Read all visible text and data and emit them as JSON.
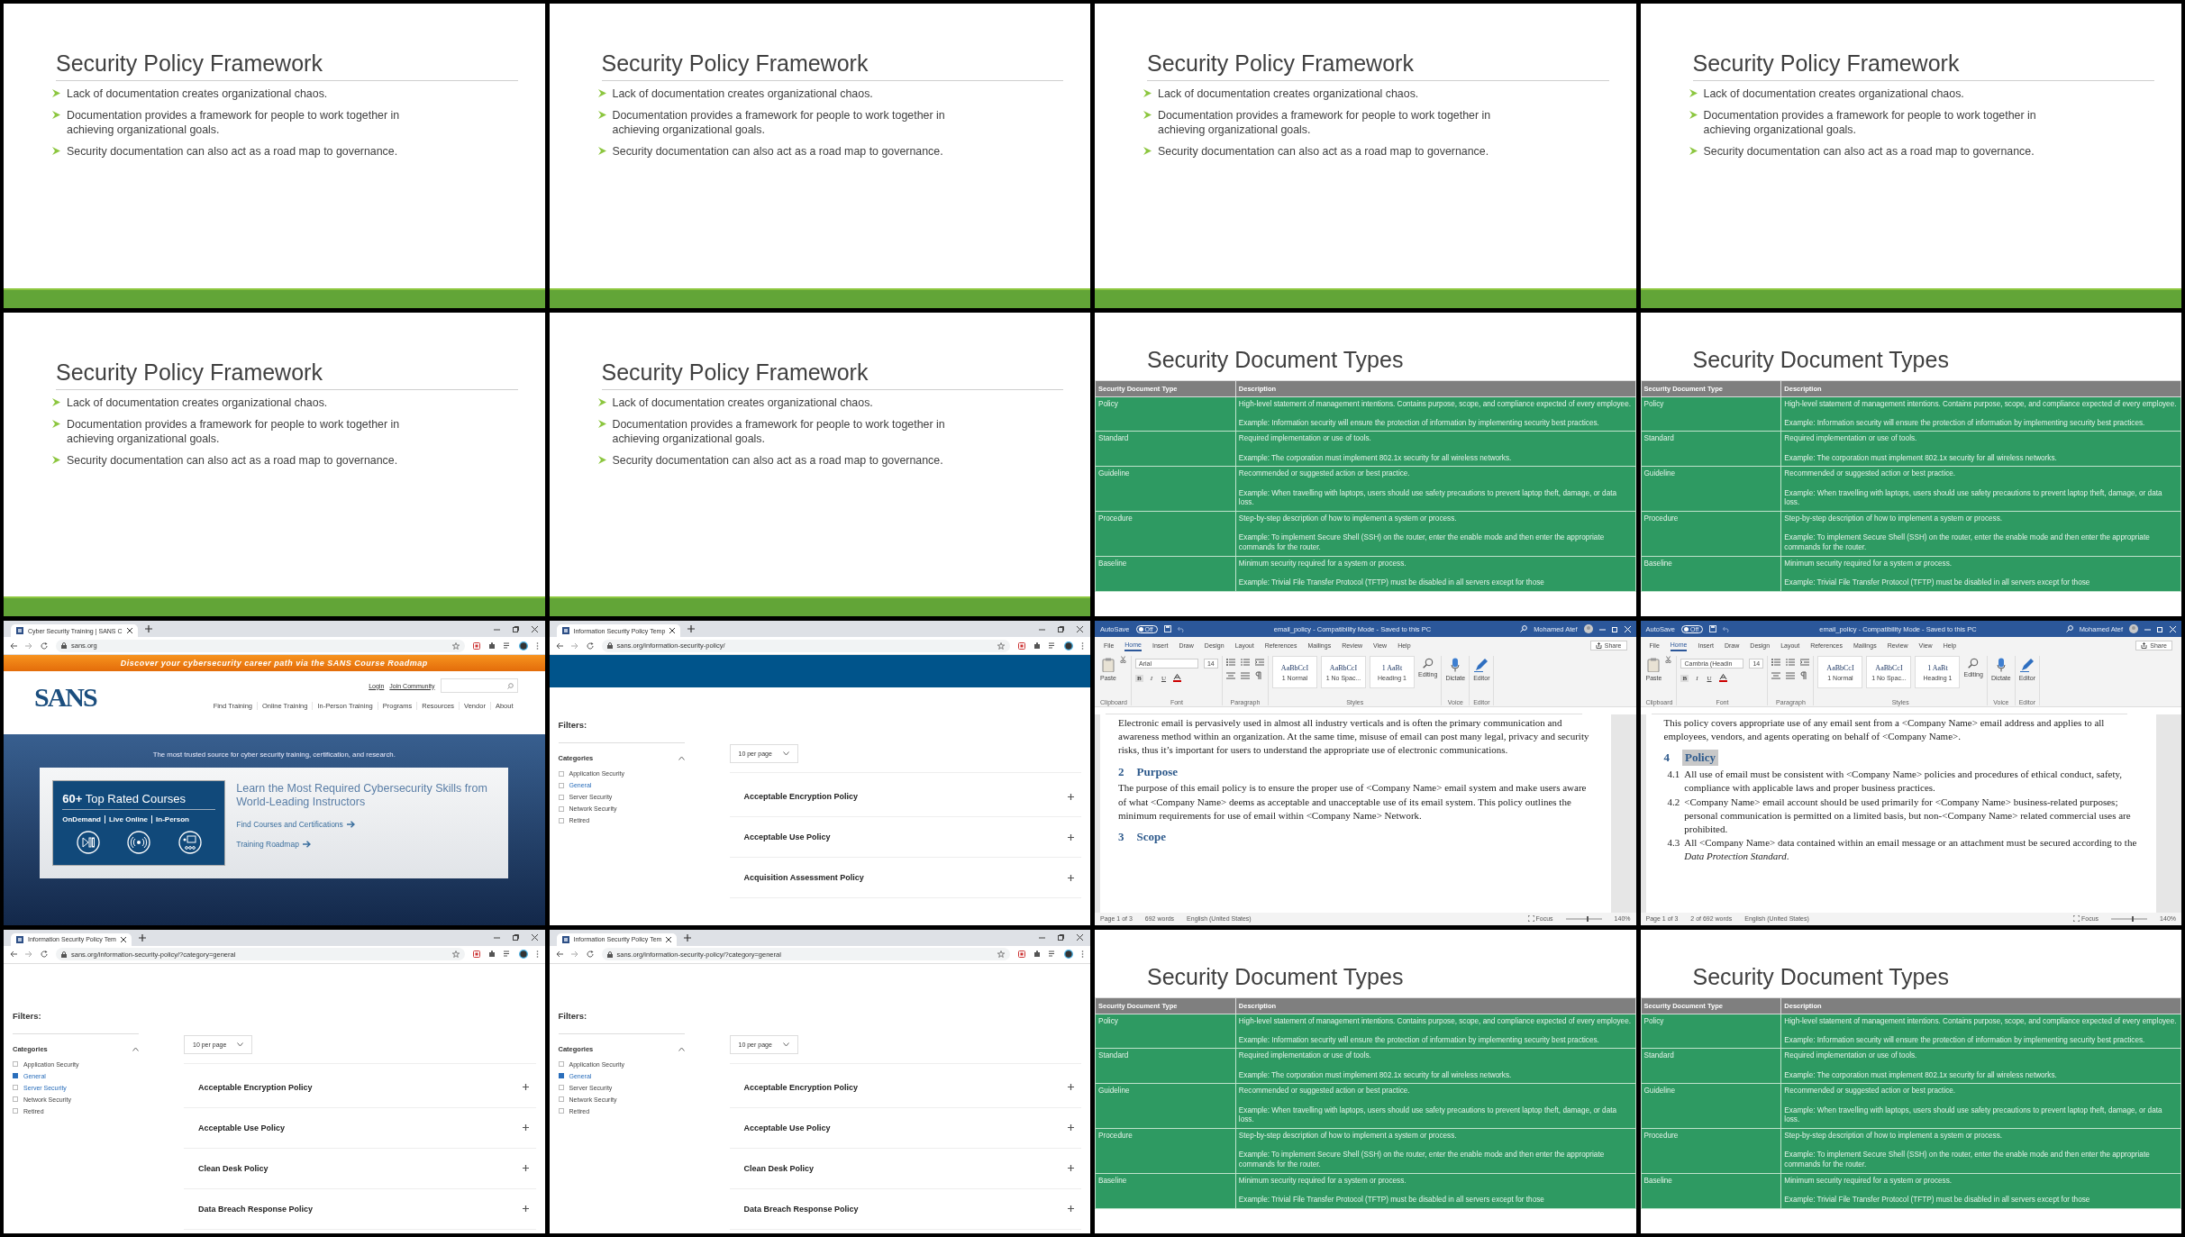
{
  "frames": [
    {
      "kind": "bullet_slide",
      "title": "Security Policy Framework",
      "bullets": [
        "Lack of documentation creates organizational chaos.",
        "Documentation provides a framework for people to work together in achieving organizational goals.",
        "Security documentation can also act as a road map to governance."
      ]
    },
    {
      "kind": "bullet_slide",
      "title": "Security Policy Framework",
      "bullets": [
        "Lack of documentation creates organizational chaos.",
        "Documentation provides a framework for people to work together in achieving organizational goals.",
        "Security documentation can also act as a road map to governance."
      ]
    },
    {
      "kind": "bullet_slide",
      "title": "Security Policy Framework",
      "bullets": [
        "Lack of documentation creates organizational chaos.",
        "Documentation provides a framework for people to work together in achieving organizational goals.",
        "Security documentation can also act as a road map to governance."
      ]
    },
    {
      "kind": "bullet_slide",
      "title": "Security Policy Framework",
      "bullets": [
        "Lack of documentation creates organizational chaos.",
        "Documentation provides a framework for people to work together in achieving organizational goals.",
        "Security documentation can also act as a road map to governance."
      ]
    },
    {
      "kind": "bullet_slide",
      "title": "Security Policy Framework",
      "bullets": [
        "Lack of documentation creates organizational chaos.",
        "Documentation provides a framework for people to work together in achieving organizational goals.",
        "Security documentation can also act as a road map to governance."
      ]
    },
    {
      "kind": "bullet_slide",
      "title": "Security Policy Framework",
      "bullets": [
        "Lack of documentation creates organizational chaos.",
        "Documentation provides a framework for people to work together in achieving organizational goals.",
        "Security documentation can also act as a road map to governance."
      ]
    },
    {
      "kind": "table_slide",
      "title": "Security Document Types",
      "columns": [
        "Security Document Type",
        "Description"
      ],
      "rows": [
        {
          "type": "Policy",
          "description": [
            "High-level statement of management intentions. Contains purpose, scope, and compliance expected of every employee.",
            "Example: Information security will ensure the protection of information by implementing security best practices."
          ]
        },
        {
          "type": "Standard",
          "description": [
            "Required implementation or use of tools.",
            "Example: The corporation must implement 802.1x security for all wireless networks."
          ]
        },
        {
          "type": "Guideline",
          "description": [
            "Recommended or suggested action or best practice.",
            "Example: When travelling with laptops, users should use safety precautions to prevent laptop theft, damage, or data loss."
          ]
        },
        {
          "type": "Procedure",
          "description": [
            "Step-by-step description of how to implement a system or process.",
            "Example: To implement Secure Shell (SSH) on the router, enter the enable mode and then enter the appropriate commands for the router."
          ]
        },
        {
          "type": "Baseline",
          "description": [
            "Minimum security required for a system or process.",
            "Example: Trivial File Transfer Protocol (TFTP) must be disabled in all servers except for those"
          ]
        }
      ]
    },
    {
      "kind": "table_slide",
      "title": "Security Document Types",
      "columns": [
        "Security Document Type",
        "Description"
      ],
      "rows": [
        {
          "type": "Policy",
          "description": [
            "High-level statement of management intentions. Contains purpose, scope, and compliance expected of every employee.",
            "Example: Information security will ensure the protection of information by implementing security best practices."
          ]
        },
        {
          "type": "Standard",
          "description": [
            "Required implementation or use of tools.",
            "Example: The corporation must implement 802.1x security for all wireless networks."
          ]
        },
        {
          "type": "Guideline",
          "description": [
            "Recommended or suggested action or best practice.",
            "Example: When travelling with laptops, users should use safety precautions to prevent laptop theft, damage, or data loss."
          ]
        },
        {
          "type": "Procedure",
          "description": [
            "Step-by-step description of how to implement a system or process.",
            "Example: To implement Secure Shell (SSH) on the router, enter the enable mode and then enter the appropriate commands for the router."
          ]
        },
        {
          "type": "Baseline",
          "description": [
            "Minimum security required for a system or process.",
            "Example: Trivial File Transfer Protocol (TFTP) must be disabled in all servers except for those"
          ]
        }
      ]
    },
    {
      "kind": "sans_home",
      "tab_title": "Cyber Security Training | SANS C",
      "url": "sans.org",
      "promo_banner": "Discover your cybersecurity career path via the SANS Course Roadmap",
      "logo": "SANS",
      "top_links": [
        "Login",
        "Join Community"
      ],
      "nav": [
        "Find Training",
        "Online Training",
        "In-Person Training",
        "Programs",
        "Resources",
        "Vendor",
        "About"
      ],
      "tagline": "The most trusted source for cyber security training, certification, and research.",
      "courses_title": "**60+** Top Rated Courses",
      "formats": [
        "OnDemand",
        "Live Online",
        "In-Person"
      ],
      "headline": "Learn the Most Required Cybersecurity Skills from World-Leading Instructors",
      "links": [
        "Find Courses and Certifications",
        "Training Roadmap"
      ]
    },
    {
      "kind": "sans_filter",
      "tab_title": "Information Security Policy Temp",
      "url": "sans.org/information-security-policy/",
      "banner": true,
      "filters_title": "Filters:",
      "categories_title": "Categories",
      "categories": [
        {
          "label": "Application Security",
          "checked": false,
          "hovered": false
        },
        {
          "label": "General",
          "checked": false,
          "hovered": true
        },
        {
          "label": "Server Security",
          "checked": false,
          "hovered": false
        },
        {
          "label": "Network Security",
          "checked": false,
          "hovered": false
        },
        {
          "label": "Retired",
          "checked": false,
          "hovered": false
        }
      ],
      "per_page": "10 per page",
      "policies": [
        "Acceptable Encryption Policy",
        "Acceptable Use Policy",
        "Acquisition Assessment Policy"
      ]
    },
    {
      "kind": "word",
      "autosave": "AutoSave",
      "autosave_toggle": {
        "label": "Off",
        "on": false
      },
      "title": "email_policy - Compatibility Mode - Saved to this PC",
      "user": "Mohamed Atef",
      "tabs": [
        {
          "label": "File",
          "selected": false
        },
        {
          "label": "Home",
          "selected": true
        },
        {
          "label": "Insert",
          "selected": false
        },
        {
          "label": "Draw",
          "selected": false
        },
        {
          "label": "Design",
          "selected": false
        },
        {
          "label": "Layout",
          "selected": false
        },
        {
          "label": "References",
          "selected": false
        },
        {
          "label": "Mailings",
          "selected": false
        },
        {
          "label": "Review",
          "selected": false
        },
        {
          "label": "View",
          "selected": false
        },
        {
          "label": "Help",
          "selected": false
        }
      ],
      "share": "Share",
      "paste": "Paste",
      "font": "Arial",
      "size": "14",
      "format_buttons": [
        "B",
        "I",
        "U"
      ],
      "styles": [
        {
          "preview": "AaBbCcI",
          "name": "1 Normal"
        },
        {
          "preview": "AaBbCcI",
          "name": "1 No Spac..."
        },
        {
          "preview": "1 AaBt",
          "name": "Heading 1"
        }
      ],
      "editing": "Editing",
      "dictate": "Dictate",
      "editor": "Editor",
      "groups": [
        "Clipboard",
        "Font",
        "Paragraph",
        "Styles",
        "Voice",
        "Editor"
      ],
      "body": [
        {
          "kind": "para",
          "text": "Electronic email is pervasively used in almost all industry verticals and is often the primary communication and awareness method within an organization. At the same time, misuse of email can post many legal, privacy and security risks, thus it’s important for users to understand the appropriate use of electronic communications."
        },
        {
          "kind": "heading",
          "number": "2",
          "text": "Purpose",
          "selected": false
        },
        {
          "kind": "para",
          "text": "The purpose of this email policy is to ensure the proper use of <Company Name> email system and make users aware of what <Company Name> deems as acceptable and unacceptable use of its email system. This policy outlines the minimum requirements for use of email within <Company Name> Network."
        },
        {
          "kind": "heading",
          "number": "3",
          "text": "Scope",
          "selected": false
        }
      ],
      "status": [
        "Page 1 of 3",
        "692 words",
        "English (United States)"
      ],
      "focus": "Focus",
      "zoom": "140%"
    },
    {
      "kind": "word",
      "autosave": "AutoSave",
      "autosave_toggle": {
        "label": "Off",
        "on": false
      },
      "title": "email_policy - Compatibility Mode - Saved to this PC",
      "user": "Mohamed Atef",
      "tabs": [
        {
          "label": "File",
          "selected": false
        },
        {
          "label": "Home",
          "selected": true
        },
        {
          "label": "Insert",
          "selected": false
        },
        {
          "label": "Draw",
          "selected": false
        },
        {
          "label": "Design",
          "selected": false
        },
        {
          "label": "Layout",
          "selected": false
        },
        {
          "label": "References",
          "selected": false
        },
        {
          "label": "Mailings",
          "selected": false
        },
        {
          "label": "Review",
          "selected": false
        },
        {
          "label": "View",
          "selected": false
        },
        {
          "label": "Help",
          "selected": false
        }
      ],
      "share": "Share",
      "paste": "Paste",
      "font": "Cambria (Headin",
      "size": "14",
      "format_buttons": [
        "B",
        "I",
        "U"
      ],
      "styles": [
        {
          "preview": "AaBbCcI",
          "name": "1 Normal"
        },
        {
          "preview": "AaBbCcI",
          "name": "1 No Spac..."
        },
        {
          "preview": "1 AaBt",
          "name": "Heading 1"
        }
      ],
      "editing": "Editing",
      "dictate": "Dictate",
      "editor": "Editor",
      "groups": [
        "Clipboard",
        "Font",
        "Paragraph",
        "Styles",
        "Voice",
        "Editor"
      ],
      "body": [
        {
          "kind": "para",
          "text": "This policy covers appropriate use of any email sent from a <Company Name> email address and applies to all employees, vendors, and agents operating on behalf of <Company Name>."
        },
        {
          "kind": "heading",
          "number": "4",
          "text": "Policy",
          "selected": true
        },
        {
          "kind": "item",
          "number": "4.1",
          "text": "All use of email must be consistent with <Company Name> policies and procedures of ethical conduct, safety, compliance with applicable laws and proper business practices."
        },
        {
          "kind": "item",
          "number": "4.2",
          "text": "<Company Name> email account should be used primarily for <Company Name> business-related purposes; personal communication is permitted on a limited basis, but non-<Company Name>   related commercial uses are prohibited."
        },
        {
          "kind": "item",
          "number": "4.3",
          "text": "All <Company Name> data contained within an email message or an attachment must be secured according to the *Data Protection Standard*."
        }
      ],
      "status": [
        "Page 1 of 3",
        "2 of 692 words",
        "English (United States)"
      ],
      "focus": "Focus",
      "zoom": "140%"
    },
    {
      "kind": "sans_filter",
      "tab_title": "Information Security Policy Tem",
      "url": "sans.org/information-security-policy/?category=general",
      "banner": false,
      "filters_title": "Filters:",
      "categories_title": "Categories",
      "categories": [
        {
          "label": "Application Security",
          "checked": false,
          "hovered": false
        },
        {
          "label": "General",
          "checked": true,
          "hovered": false
        },
        {
          "label": "Server Security",
          "checked": false,
          "hovered": true
        },
        {
          "label": "Network Security",
          "checked": false,
          "hovered": false
        },
        {
          "label": "Retired",
          "checked": false,
          "hovered": false
        }
      ],
      "per_page": "10 per page",
      "policies": [
        "Acceptable Encryption Policy",
        "Acceptable Use Policy",
        "Clean Desk Policy",
        "Data Breach Response Policy"
      ]
    },
    {
      "kind": "sans_filter",
      "tab_title": "Information Security Policy Tem",
      "url": "sans.org/information-security-policy/?category=general",
      "banner": false,
      "filters_title": "Filters:",
      "categories_title": "Categories",
      "categories": [
        {
          "label": "Application Security",
          "checked": false,
          "hovered": false
        },
        {
          "label": "General",
          "checked": true,
          "hovered": false
        },
        {
          "label": "Server Security",
          "checked": false,
          "hovered": false
        },
        {
          "label": "Network Security",
          "checked": false,
          "hovered": false
        },
        {
          "label": "Retired",
          "checked": false,
          "hovered": false
        }
      ],
      "per_page": "10 per page",
      "policies": [
        "Acceptable Encryption Policy",
        "Acceptable Use Policy",
        "Clean Desk Policy",
        "Data Breach Response Policy"
      ]
    },
    {
      "kind": "table_slide",
      "title": "Security Document Types",
      "columns": [
        "Security Document Type",
        "Description"
      ],
      "rows": [
        {
          "type": "Policy",
          "description": [
            "High-level statement of management intentions. Contains purpose, scope, and compliance expected of every employee.",
            "Example: Information security will ensure the protection of information by implementing security best practices."
          ]
        },
        {
          "type": "Standard",
          "description": [
            "Required implementation or use of tools.",
            "Example: The corporation must implement 802.1x security for all wireless networks."
          ]
        },
        {
          "type": "Guideline",
          "description": [
            "Recommended or suggested action or best practice.",
            "Example: When travelling with laptops, users should use safety precautions to prevent laptop theft, damage, or data loss."
          ]
        },
        {
          "type": "Procedure",
          "description": [
            "Step-by-step description of how to implement a system or process.",
            "Example: To implement Secure Shell (SSH) on the router, enter the enable mode and then enter the appropriate commands for the router."
          ]
        },
        {
          "type": "Baseline",
          "description": [
            "Minimum security required for a system or process.",
            "Example: Trivial File Transfer Protocol (TFTP) must be disabled in all servers except for those"
          ]
        }
      ]
    },
    {
      "kind": "table_slide",
      "title": "Security Document Types",
      "columns": [
        "Security Document Type",
        "Description"
      ],
      "rows": [
        {
          "type": "Policy",
          "description": [
            "High-level statement of management intentions. Contains purpose, scope, and compliance expected of every employee.",
            "Example: Information security will ensure the protection of information by implementing security best practices."
          ]
        },
        {
          "type": "Standard",
          "description": [
            "Required implementation or use of tools.",
            "Example: The corporation must implement 802.1x security for all wireless networks."
          ]
        },
        {
          "type": "Guideline",
          "description": [
            "Recommended or suggested action or best practice.",
            "Example: When travelling with laptops, users should use safety precautions to prevent laptop theft, damage, or data loss."
          ]
        },
        {
          "type": "Procedure",
          "description": [
            "Step-by-step description of how to implement a system or process.",
            "Example: To implement Secure Shell (SSH) on the router, enter the enable mode and then enter the appropriate commands for the router."
          ]
        },
        {
          "type": "Baseline",
          "description": [
            "Minimum security required for a system or process.",
            "Example: Trivial File Transfer Protocol (TFTP) must be disabled in all servers except for those"
          ]
        }
      ]
    }
  ]
}
